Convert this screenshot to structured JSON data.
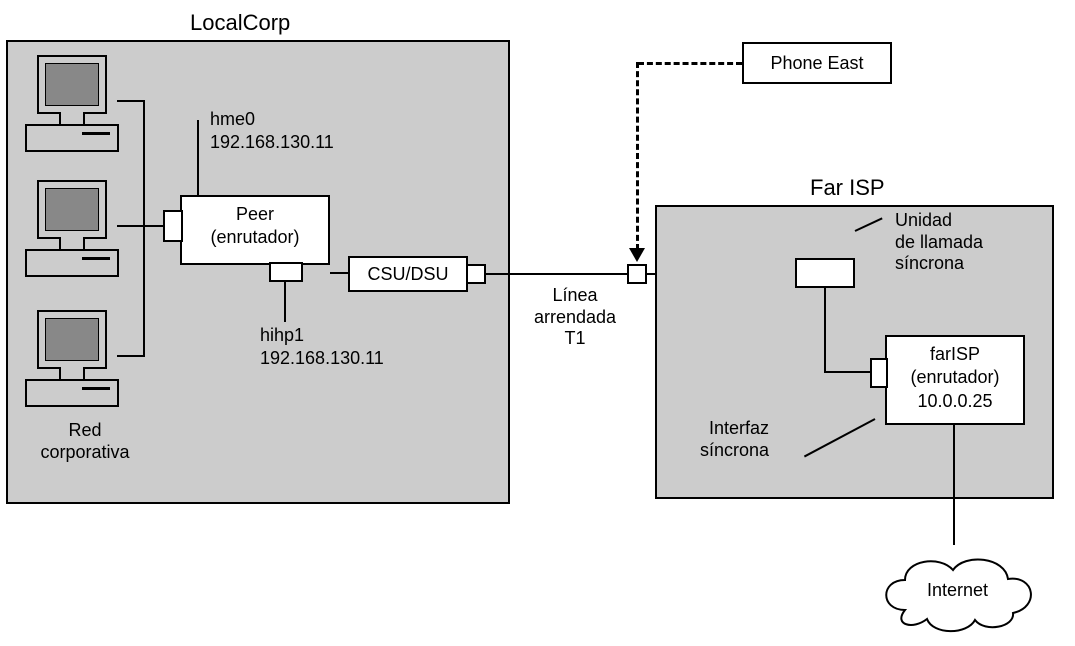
{
  "localcorp": {
    "title": "LocalCorp",
    "corp_net": "Red\ncorporativa",
    "peer_box": "Peer\n(enrutador)",
    "csu_dsu": "CSU/DSU",
    "hme0_name": "hme0",
    "hme0_ip": "192.168.130.11",
    "hihp1_name": "hihp1",
    "hihp1_ip": "192.168.130.11"
  },
  "link": {
    "leased_line": "Línea\narrendada\nT1",
    "phone_east": "Phone East"
  },
  "farisp": {
    "title": "Far ISP",
    "sync_call_unit": "Unidad\nde llamada\nsíncrona",
    "sync_iface": "Interfaz\nsíncrona",
    "router_name": "farISP",
    "router_role": "(enrutador)",
    "router_ip": "10.0.0.25",
    "internet": "Internet"
  }
}
